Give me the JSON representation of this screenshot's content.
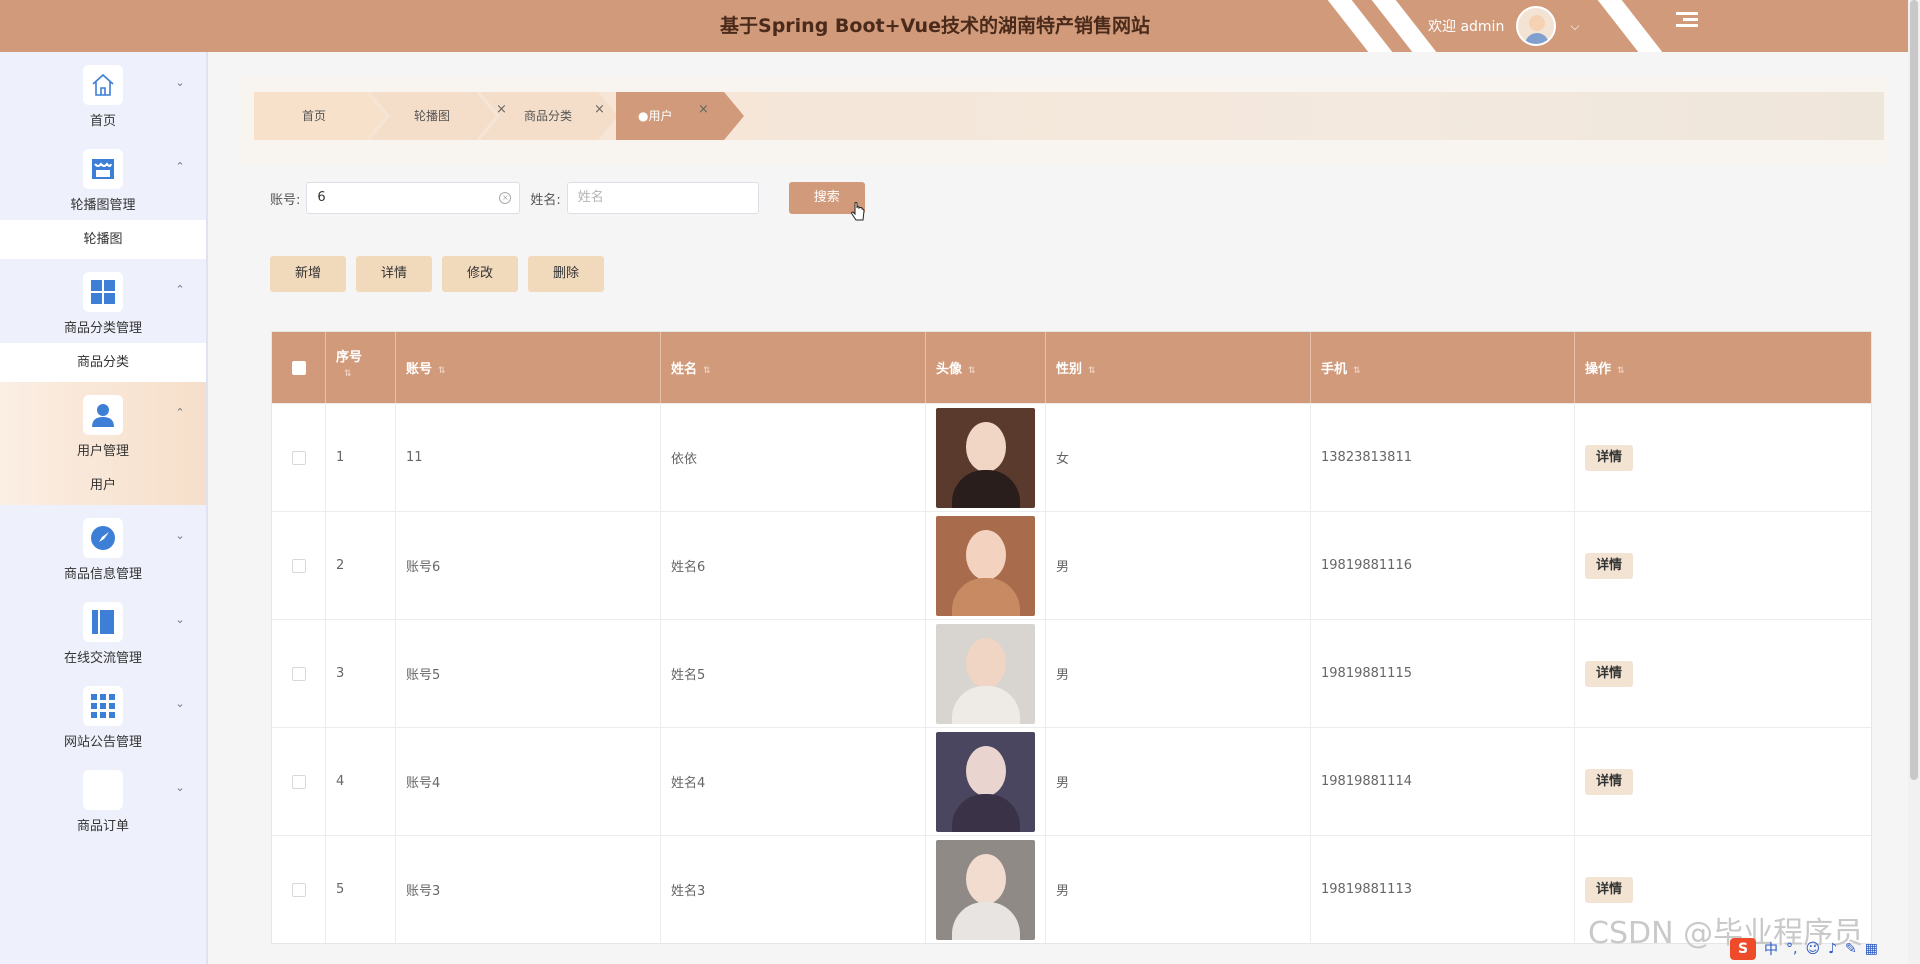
{
  "header": {
    "title": "基于Spring Boot+Vue技术的湖南特产销售网站",
    "welcome": "欢迎 admin"
  },
  "sidebar": {
    "groups": [
      {
        "label": "首页",
        "icon": "home-icon",
        "expanded": false
      },
      {
        "label": "轮播图管理",
        "icon": "shop-icon",
        "expanded": true,
        "sub": "轮播图"
      },
      {
        "label": "商品分类管理",
        "icon": "grid-icon",
        "expanded": true,
        "sub": "商品分类"
      },
      {
        "label": "用户管理",
        "icon": "user-icon",
        "expanded": true,
        "sub": "用户",
        "active": true
      },
      {
        "label": "商品信息管理",
        "icon": "compass-icon",
        "expanded": false
      },
      {
        "label": "在线交流管理",
        "icon": "panel-icon",
        "expanded": false
      },
      {
        "label": "网站公告管理",
        "icon": "apps-icon",
        "expanded": false
      },
      {
        "label": "商品订单",
        "icon": "blank-icon",
        "expanded": false
      }
    ]
  },
  "tabs": [
    {
      "label": "首页",
      "closable": false
    },
    {
      "label": "轮播图",
      "closable": true
    },
    {
      "label": "商品分类",
      "closable": true
    },
    {
      "label": "●用户",
      "closable": true,
      "active": true
    }
  ],
  "search": {
    "account_label": "账号:",
    "account_value": "6",
    "name_label": "姓名:",
    "name_placeholder": "姓名",
    "button": "搜索"
  },
  "actions": [
    "新增",
    "详情",
    "修改",
    "删除"
  ],
  "table": {
    "columns": [
      "序号",
      "账号",
      "姓名",
      "头像",
      "性别",
      "手机",
      "操作"
    ],
    "rows": [
      {
        "index": "1",
        "account": "11",
        "name": "依依",
        "gender": "女",
        "phone": "13823813811",
        "op": "详情"
      },
      {
        "index": "2",
        "account": "账号6",
        "name": "姓名6",
        "gender": "男",
        "phone": "19819881116",
        "op": "详情"
      },
      {
        "index": "3",
        "account": "账号5",
        "name": "姓名5",
        "gender": "男",
        "phone": "19819881115",
        "op": "详情"
      },
      {
        "index": "4",
        "account": "账号4",
        "name": "姓名4",
        "gender": "男",
        "phone": "19819881114",
        "op": "详情"
      },
      {
        "index": "5",
        "account": "账号3",
        "name": "姓名3",
        "gender": "男",
        "phone": "19819881113",
        "op": "详情"
      }
    ]
  },
  "watermark": "CSDN @毕业程序员",
  "ime": {
    "badge": "S",
    "mode": "中"
  },
  "colors": {
    "accent": "#d19a7a",
    "sidebar_bg": "#eef1fb",
    "icon_blue": "#3d7fd6",
    "button_light": "#f1d9bc"
  }
}
